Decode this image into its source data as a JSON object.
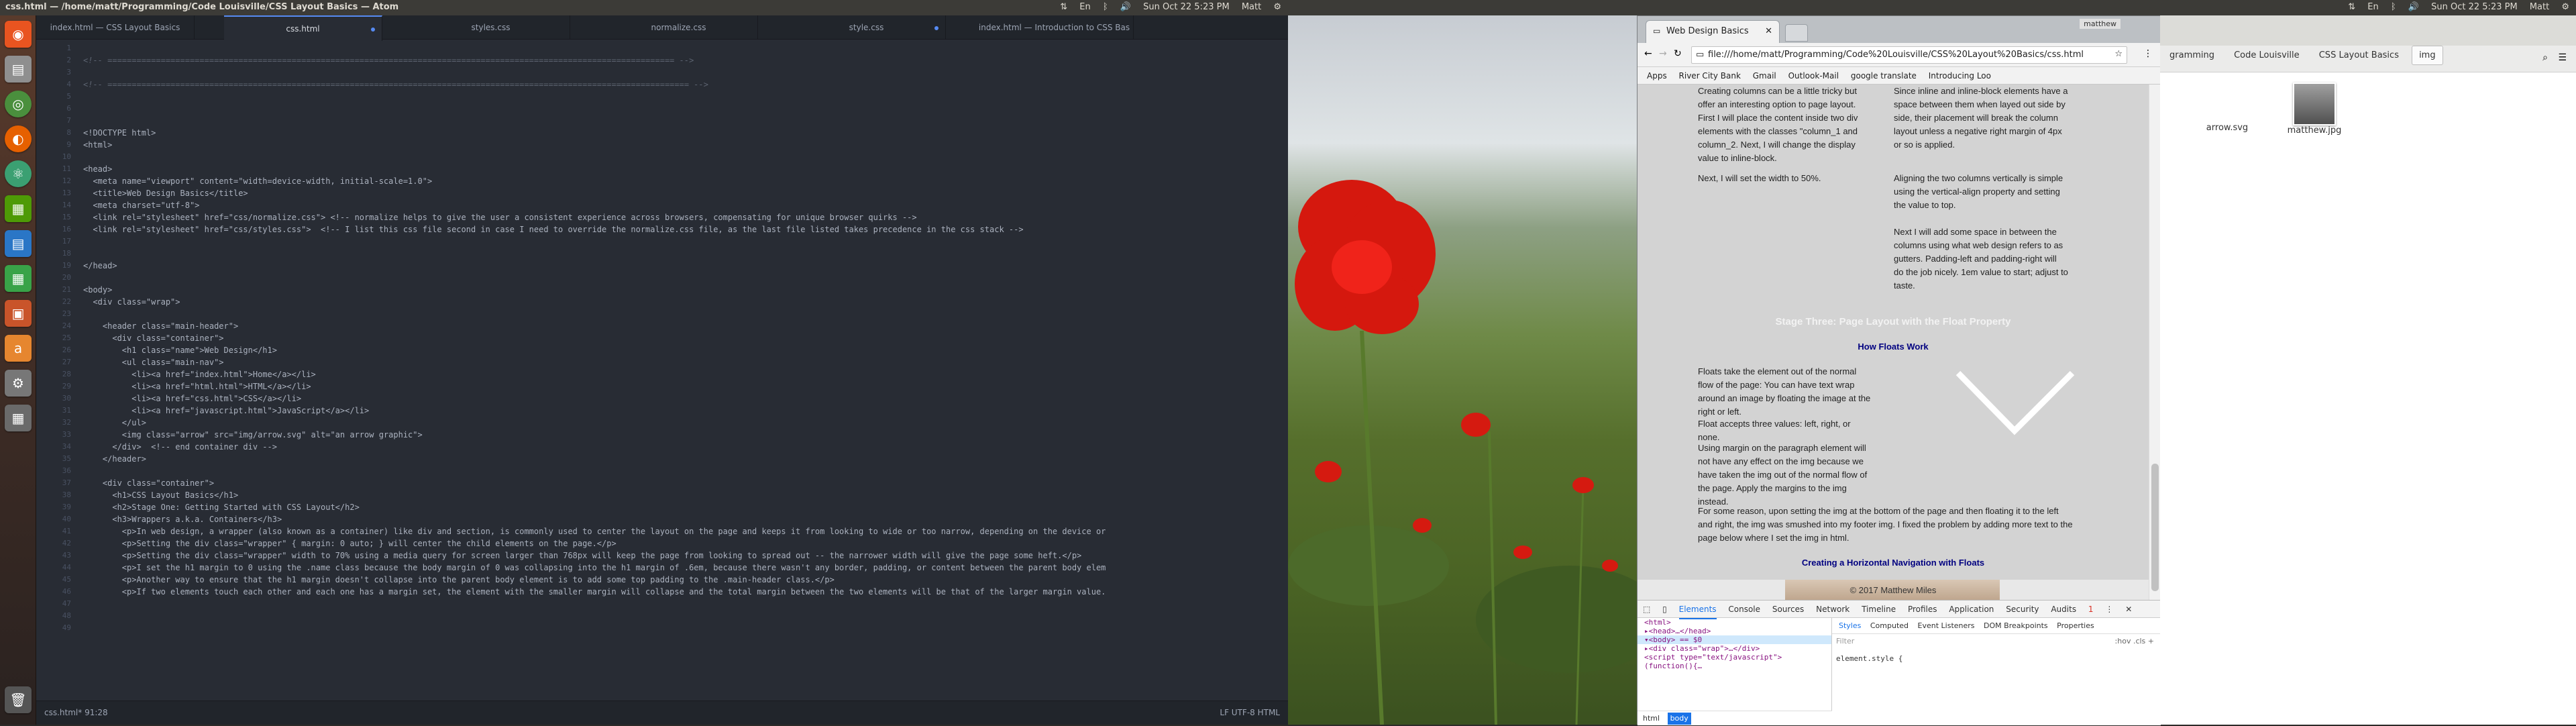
{
  "system": {
    "left_title": "css.html — /home/matt/Programming/Code Louisville/CSS Layout Basics — Atom",
    "datetime": "Sun Oct 22 5:23 PM",
    "user": "Matt",
    "kb": "En"
  },
  "launcher": [
    "ubuntu-software-icon",
    "files-icon",
    "chrome-icon",
    "firefox-icon",
    "atom-icon",
    "terminal-icon",
    "libreoffice-writer-icon",
    "libreoffice-calc-icon",
    "libreoffice-impress-icon",
    "amazon-icon",
    "settings-icon",
    "calculator-icon",
    "trash-icon"
  ],
  "atom": {
    "tabs": [
      {
        "label": "index.html — CSS Layout Basics"
      },
      {
        "label": "css.html"
      },
      {
        "label": "styles.css"
      },
      {
        "label": "normalize.css"
      },
      {
        "label": "style.css"
      },
      {
        "label": "index.html — Introduction to CSS Bas"
      }
    ],
    "line_numbers": [
      "1",
      "2",
      "3",
      "4",
      "5",
      "6",
      "7",
      "8",
      "9",
      "10",
      "11",
      "12",
      "13",
      "14",
      "15",
      "16",
      "17",
      "18",
      "19",
      "20",
      "21",
      "22",
      "23",
      "24",
      "25",
      "26",
      "27",
      "28",
      "29",
      "30",
      "31",
      "32",
      "33",
      "34",
      "35",
      "36",
      "37",
      "38",
      "39",
      "40",
      "41",
      "42",
      "43",
      "44",
      "45",
      "46",
      "47",
      "48",
      "49"
    ],
    "lines": [
      "",
      "<!-- ===================================================================================================================== -->",
      "",
      "<!-- ======================================================================================================================== -->",
      "",
      "",
      "",
      "<!DOCTYPE html>",
      "<html>",
      "",
      "<head>",
      "  <meta name=\"viewport\" content=\"width=device-width, initial-scale=1.0\">",
      "  <title>Web Design Basics</title>",
      "  <meta charset=\"utf-8\">",
      "  <link rel=\"stylesheet\" href=\"css/normalize.css\"> <!-- normalize helps to give the user a consistent experience across browsers, compensating for unique browser quirks -->",
      "  <link rel=\"stylesheet\" href=\"css/styles.css\">  <!-- I list this css file second in case I need to override the normalize.css file, as the last file listed takes precedence in the css stack -->",
      "",
      "",
      "</head>",
      "",
      "<body>",
      "  <div class=\"wrap\">",
      "",
      "    <header class=\"main-header\">",
      "      <div class=\"container\">",
      "        <h1 class=\"name\">Web Design</h1>",
      "        <ul class=\"main-nav\">",
      "          <li><a href=\"index.html\">Home</a></li>",
      "          <li><a href=\"html.html\">HTML</a></li>",
      "          <li><a href=\"css.html\">CSS</a></li>",
      "          <li><a href=\"javascript.html\">JavaScript</a></li>",
      "        </ul>",
      "        <img class=\"arrow\" src=\"img/arrow.svg\" alt=\"an arrow graphic\">",
      "      </div>  <!-- end container div -->",
      "    </header>",
      "",
      "    <div class=\"container\">",
      "      <h1>CSS Layout Basics</h1>",
      "      <h2>Stage One: Getting Started with CSS Layout</h2>",
      "      <h3>Wrappers a.k.a. Containers</h3>",
      "        <p>In web design, a wrapper (also known as a container) like div and section, is commonly used to center the layout on the page and keeps it from looking to wide or too narrow, depending on the device or",
      "        <p>Setting the div class=\"wrapper\" { margin: 0 auto; } will center the child elements on the page.</p>",
      "        <p>Setting the div class=\"wrapper\" width to 70% using a media query for screen larger than 768px will keep the page from looking to spread out -- the narrower width will give the page some heft.</p>",
      "        <p>I set the h1 margin to 0 using the .name class because the body margin of 0 was collapsing into the h1 margin of .6em, because there wasn't any border, padding, or content between the parent body elem",
      "        <p>Another way to ensure that the h1 margin doesn't collapse into the parent body element is to add some top padding to the .main-header class.</p>",
      "        <p>If two elements touch each other and each one has a margin set, the element with the smaller margin will collapse and the total margin between the two elements will be that of the larger margin value.",
      "",
      "",
      ""
    ],
    "status_left": "css.html*   91:28",
    "status_right": "LF   UTF-8   HTML"
  },
  "chrome": {
    "tab_title": "Web Design Basics",
    "url": "file:///home/matt/Programming/Code%20Louisville/CSS%20Layout%20Basics/css.html",
    "window_label": "matthew",
    "bookmarks": [
      "Apps",
      "River City Bank",
      "Gmail",
      "Outlook-Mail",
      "google translate",
      "Introducing Loo"
    ],
    "page": {
      "col1": [
        "Creating columns can be a little tricky but offer an interesting option to page layout. First I will place the content inside two div elements with the classes \"column_1 and column_2. Next, I will change the display value to inline-block.",
        "Next, I will set the width to 50%."
      ],
      "col2": [
        "Since inline and inline-block elements have a space between them when layed out side by side, their placement will break the column layout unless a negative right margin of 4px or so is applied.",
        "Aligning the two columns vertically is simple using the vertical-align property and setting the value to top.",
        "Next I will add some space in between the columns using what web design refers to as gutters. Padding-left and padding-right will do the job nicely. 1em value to start; adjust to taste."
      ],
      "stage3": "Stage Three: Page Layout with the Float Property",
      "how_floats": "How Floats Work",
      "float_paras": [
        "Floats take the element out of the normal flow of the page: You can have text wrap around an image by floating the image at the right or left.",
        "Float accepts three values: left, right, or none.",
        "Using margin on the paragraph element will not have any effect on the img because we have taken the img out of the normal flow of the page. Apply the margins to the img instead.",
        "For some reason, upon setting the img at the bottom of the page and then floating it to the left and right, the img was smushed into my footer img. I fixed the problem by adding more text to the page below where I set the img in html."
      ],
      "horizontal_nav": "Creating a Horizontal Navigation with Floats",
      "footer": "© 2017 Matthew Miles"
    },
    "devtools": {
      "tabs": [
        "Elements",
        "Console",
        "Sources",
        "Network",
        "Timeline",
        "Profiles",
        "Application",
        "Security",
        "Audits"
      ],
      "error_count": "1",
      "dom": [
        "<html>",
        "▸<head>…</head>",
        "▾<body> == $0",
        "  ▸<div class=\"wrap\">…</div>",
        "    <script type=\"text/javascript\"> (function(){…",
        "  "
      ],
      "side_tabs": [
        "Styles",
        "Computed",
        "Event Listeners",
        "DOM Breakpoints",
        "Properties"
      ],
      "filter": "Filter",
      "hov": ":hov  .cls  +",
      "element_style": "element.style {",
      "breadcrumbs": [
        "html",
        "body"
      ]
    }
  },
  "files": {
    "crumbs": [
      "gramming",
      "Code Louisville",
      "CSS Layout Basics",
      "img"
    ],
    "items": [
      {
        "name": "arrow.svg"
      },
      {
        "name": "matthew.jpg"
      }
    ]
  }
}
